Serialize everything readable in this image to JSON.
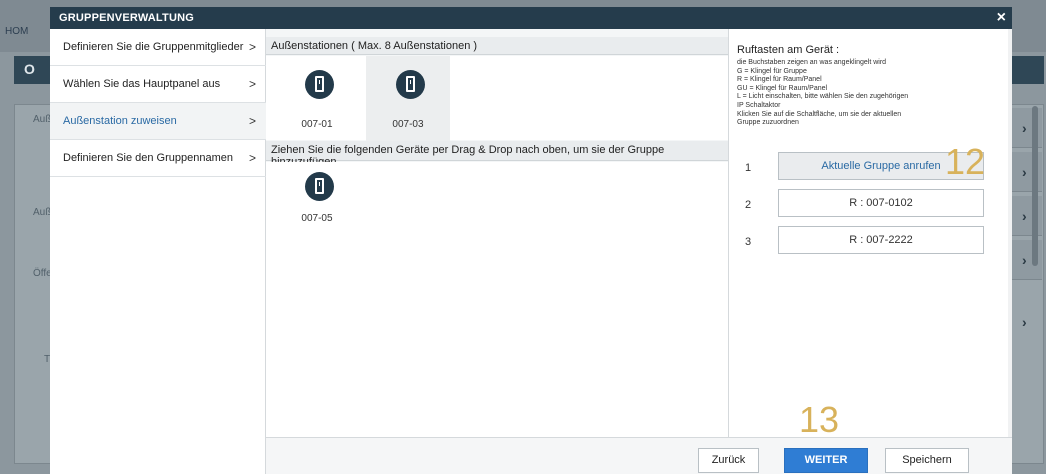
{
  "background": {
    "home_label": "HOM",
    "band_letter": "O",
    "labels": [
      "Auß",
      "Auß",
      "Öffe",
      "T"
    ]
  },
  "modal": {
    "title": "GRUPPENVERWALTUNG",
    "close_symbol": "×"
  },
  "nav": {
    "items": [
      {
        "label": "Definieren Sie die Gruppenmitglieder",
        "chevron": ">",
        "active": false
      },
      {
        "label": "Wählen Sie das Hauptpanel aus",
        "chevron": ">",
        "active": false
      },
      {
        "label": "Außenstation zuweisen",
        "chevron": ">",
        "active": true
      },
      {
        "label": "Definieren Sie den Gruppennamen",
        "chevron": ">",
        "active": false
      }
    ]
  },
  "center": {
    "assigned_header": "Außenstationen ( Max. 8 Außenstationen )",
    "assigned_devices": [
      {
        "label": "007-01",
        "icon": "door-station-icon",
        "selected": false
      },
      {
        "label": "007-03",
        "icon": "door-station-icon",
        "selected": true
      }
    ],
    "available_header": "Ziehen Sie die folgenden Geräte per Drag & Drop nach oben, um sie der Gruppe hinzuzufügen",
    "available_devices": [
      {
        "label": "007-05",
        "icon": "door-station-icon"
      }
    ]
  },
  "right_panel": {
    "title": "Ruftasten am Gerät :",
    "description": [
      "die Buchstaben zeigen an was angeklingelt wird",
      "G = Klingel für Gruppe",
      "R = Klingel für Raum/Panel",
      "GU = Klingel für Raum/Panel",
      "L = Licht einschalten, bitte wählen Sie den zugehörigen",
      "IP Schaltaktor",
      "Klicken Sie auf die Schaltfläche, um sie der aktuellen",
      "Gruppe zuzuordnen"
    ],
    "buttons": [
      {
        "number": "1",
        "label": "Aktuelle Gruppe anrufen"
      },
      {
        "number": "2",
        "label": "R : 007-0102"
      },
      {
        "number": "3",
        "label": "R : 007-2222"
      }
    ],
    "callout_12": "12",
    "callout_13": "13"
  },
  "footer": {
    "back_label": "Zurück",
    "next_label": "WEITER",
    "save_label": "Speichern"
  },
  "colors": {
    "header": "#253c4c",
    "accent_blue": "#2f7dd4",
    "active_nav_text": "#2a6aa4",
    "device_circle": "#233a4a",
    "callout": "#d8b25b"
  }
}
